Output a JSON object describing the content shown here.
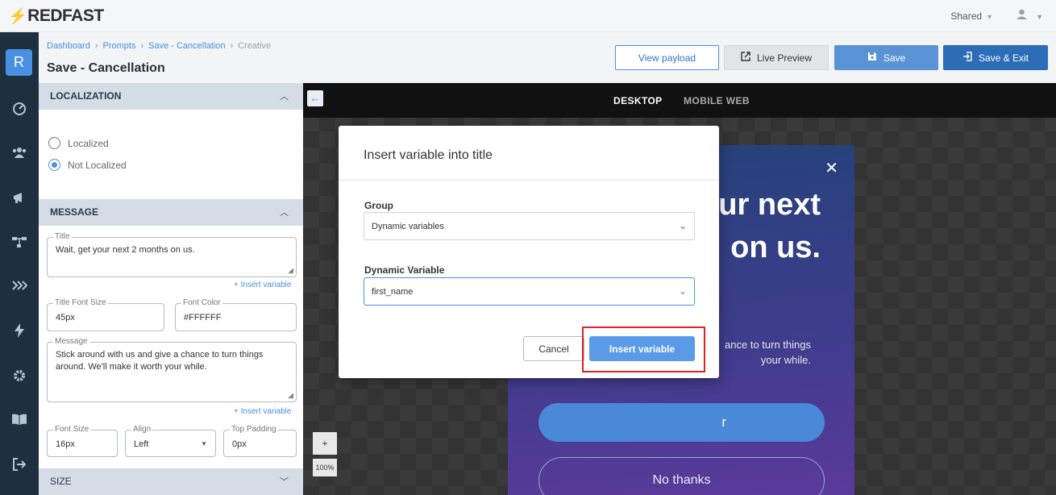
{
  "brand": {
    "name": "REDFAST",
    "accent": "#e0284b"
  },
  "topbar": {
    "shared_label": "Shared"
  },
  "rail": {
    "badge": "R"
  },
  "breadcrumb": [
    "Dashboard",
    "Prompts",
    "Save - Cancellation",
    "Creative"
  ],
  "page_title": "Save - Cancellation",
  "actions": {
    "view_payload": "View payload",
    "live_preview": "Live Preview",
    "save": "Save",
    "save_exit": "Save & Exit"
  },
  "localization": {
    "header": "LOCALIZATION",
    "options": [
      "Localized",
      "Not Localized"
    ],
    "selected": "Not Localized"
  },
  "message_section": {
    "header": "MESSAGE",
    "title_label": "Title",
    "title_value": "Wait, get your next 2 months on us.",
    "insert_variable": "+ Insert variable",
    "title_font_size_label": "Title Font Size",
    "title_font_size": "45px",
    "font_color_label": "Font Color",
    "font_color": "#FFFFFF",
    "message_label": "Message",
    "message_value": "Stick around with us and give a chance to turn things around. We'll make it worth your while.",
    "font_size_label": "Font Size",
    "font_size": "16px",
    "align_label": "Align",
    "align": "Left",
    "top_padding_label": "Top Padding",
    "top_padding": "0px"
  },
  "size_section": {
    "header": "SIZE"
  },
  "canvas": {
    "tabs": [
      "DESKTOP",
      "MOBILE WEB"
    ],
    "active_tab": "DESKTOP",
    "zoom_plus": "+",
    "zoom": "100%"
  },
  "preview": {
    "title_visible": "ur next\non us.",
    "message_visible": "ance to turn things\nyour while.",
    "cta_visible": "r",
    "decline": "No thanks"
  },
  "modal": {
    "title": "Insert variable into title",
    "group_label": "Group",
    "group_value": "Dynamic variables",
    "variable_label": "Dynamic Variable",
    "variable_value": "first_name",
    "cancel": "Cancel",
    "insert": "Insert variable"
  }
}
